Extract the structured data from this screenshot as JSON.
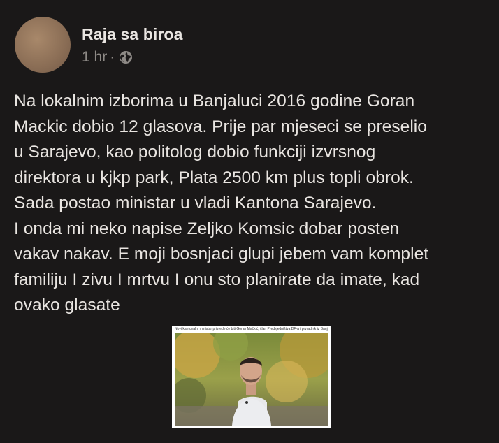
{
  "post": {
    "author": "Raja sa biroa",
    "time": "1 hr",
    "separator": "·",
    "privacy_icon": "globe-icon",
    "text": "Na lokalnim izborima u Banjaluci 2016 godine Goran\nMackic dobio 12 glasova. Prije par mjeseci se preselio\nu Sarajevo, kao politolog dobio funkciji izvrsnog\ndirektora u kjkp park, Plata 2500 km plus topli obrok.\nSada postao ministar u vladi Kantona Sarajevo.\nI onda mi neko napise Zeljko Komsic dobar posten\nvakav nakav. E moji bosnjaci glupi jebem vam komplet\nfamiliju I zivu I mrtvu I onu sto planirate da imate, kad\novako glasate",
    "image_caption": "Novi kantonalni ministar privrede će biti Goran Mačkić, član Predsjedništva DF-a i prvradnik iz Banja Luke"
  },
  "colors": {
    "background": "#1a1818",
    "text": "#e9e5e1",
    "meta": "#8e8a86"
  }
}
